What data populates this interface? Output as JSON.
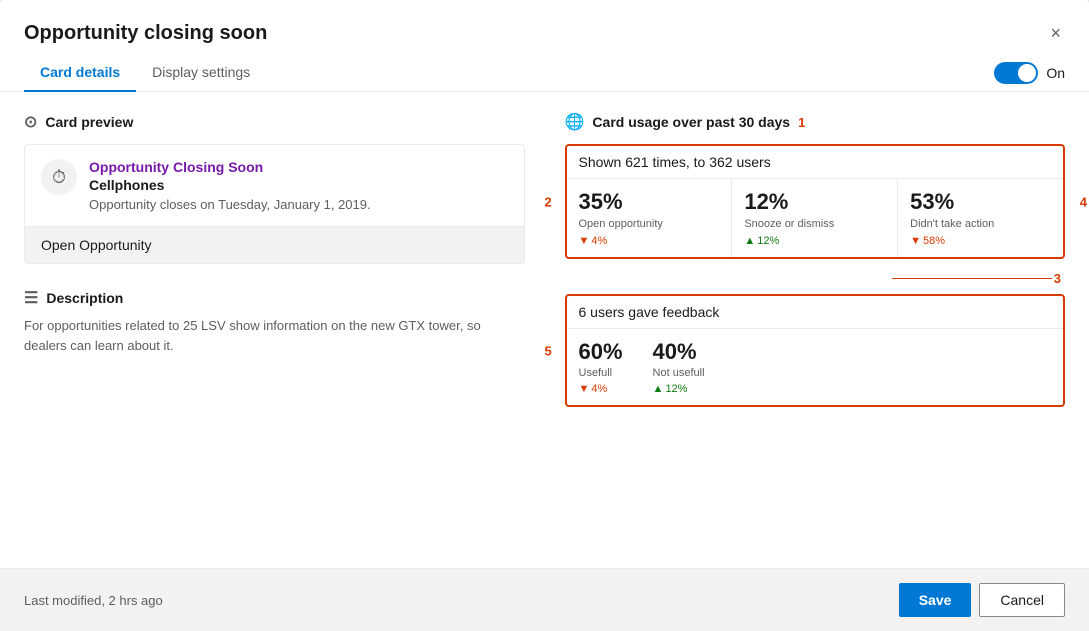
{
  "modal": {
    "title": "Opportunity closing soon",
    "close_label": "×"
  },
  "tabs": {
    "card_details": "Card details",
    "display_settings": "Display settings",
    "active": "card_details"
  },
  "toggle": {
    "state": "On"
  },
  "card_preview": {
    "section_label": "Card preview",
    "card_title": "Opportunity Closing Soon",
    "card_subtitle": "Cellphones",
    "card_body": "Opportunity closes on Tuesday, January 1, 2019.",
    "card_action": "Open Opportunity"
  },
  "description": {
    "section_label": "Description",
    "text": "For opportunities related to 25 LSV show information on the new GTX tower, so dealers can learn about it."
  },
  "usage": {
    "section_label": "Card usage over past 30 days",
    "shown_text": "Shown 621 times, to 362 users",
    "stats": [
      {
        "pct": "35%",
        "label": "Open opportunity",
        "change_dir": "down",
        "change_val": "4%",
        "arrow": "▼"
      },
      {
        "pct": "12%",
        "label": "Snooze or dismiss",
        "change_dir": "up",
        "change_val": "12%",
        "arrow": "▲"
      },
      {
        "pct": "53%",
        "label": "Didn't take action",
        "change_dir": "down",
        "change_val": "58%",
        "arrow": "▼"
      }
    ],
    "feedback_header": "6 users gave feedback",
    "feedback_stats": [
      {
        "pct": "60%",
        "label": "Usefull",
        "change_dir": "down",
        "change_val": "4%",
        "arrow": "▼"
      },
      {
        "pct": "40%",
        "label": "Not usefull",
        "change_dir": "up",
        "change_val": "12%",
        "arrow": "▲"
      }
    ]
  },
  "annotations": {
    "a1": "1",
    "a2": "2",
    "a3": "3",
    "a4": "4",
    "a5": "5"
  },
  "footer": {
    "modified": "Last modified, 2 hrs ago",
    "save": "Save",
    "cancel": "Cancel"
  }
}
